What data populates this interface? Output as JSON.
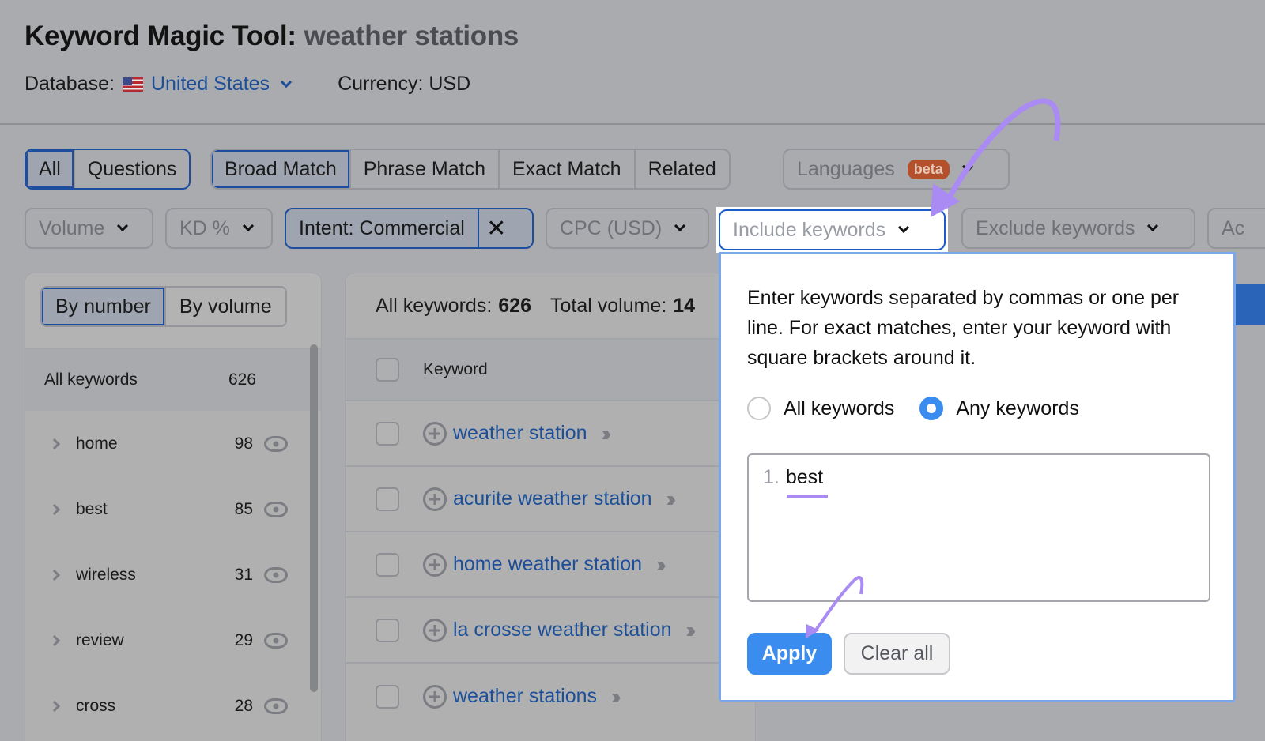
{
  "header": {
    "title": "Keyword Magic Tool:",
    "query": "weather stations",
    "database_label": "Database:",
    "database_value": "United States",
    "currency": "Currency: USD"
  },
  "match_tabs": {
    "group1": [
      "All",
      "Questions"
    ],
    "group2": [
      "Broad Match",
      "Phrase Match",
      "Exact Match",
      "Related"
    ],
    "active": [
      "All",
      "Broad Match"
    ]
  },
  "languages": {
    "label": "Languages",
    "badge": "beta"
  },
  "filters": {
    "volume": "Volume",
    "kd": "KD %",
    "intent": "Intent: Commercial",
    "intent_clear": "✕",
    "cpc": "CPC (USD)",
    "include": "Include keywords",
    "exclude": "Exclude keywords",
    "advanced_partial": "Ac"
  },
  "left_panel": {
    "toggle": [
      "By number",
      "By volume"
    ],
    "active_toggle": "By number",
    "all_keywords_label": "All keywords",
    "all_keywords_count": "626",
    "groups": [
      {
        "name": "home",
        "count": "98"
      },
      {
        "name": "best",
        "count": "85"
      },
      {
        "name": "wireless",
        "count": "31"
      },
      {
        "name": "review",
        "count": "29"
      },
      {
        "name": "cross",
        "count": "28"
      }
    ]
  },
  "table": {
    "summary_all_label": "All keywords:",
    "summary_all_count": "626",
    "summary_volume_label": "Total volume:",
    "summary_volume_value_partial": "14",
    "column_keyword": "Keyword",
    "rows": [
      {
        "keyword": "weather station"
      },
      {
        "keyword": "acurite weather station"
      },
      {
        "keyword": "home weather station"
      },
      {
        "keyword": "la crosse weather station"
      },
      {
        "keyword": "weather stations"
      }
    ]
  },
  "include_popup": {
    "description": "Enter keywords separated by commas or one per line. For exact matches, enter your keyword with square brackets around it.",
    "options": [
      "All keywords",
      "Any keywords"
    ],
    "selected_option": "Any keywords",
    "line_number": "1.",
    "entered_keyword": "best",
    "apply_label": "Apply",
    "clear_label": "Clear all"
  },
  "colors": {
    "accent_blue": "#3a8cee",
    "link_blue": "#1c4f98",
    "annotation_purple": "#a98bf3",
    "beta_badge": "#b4512c"
  }
}
